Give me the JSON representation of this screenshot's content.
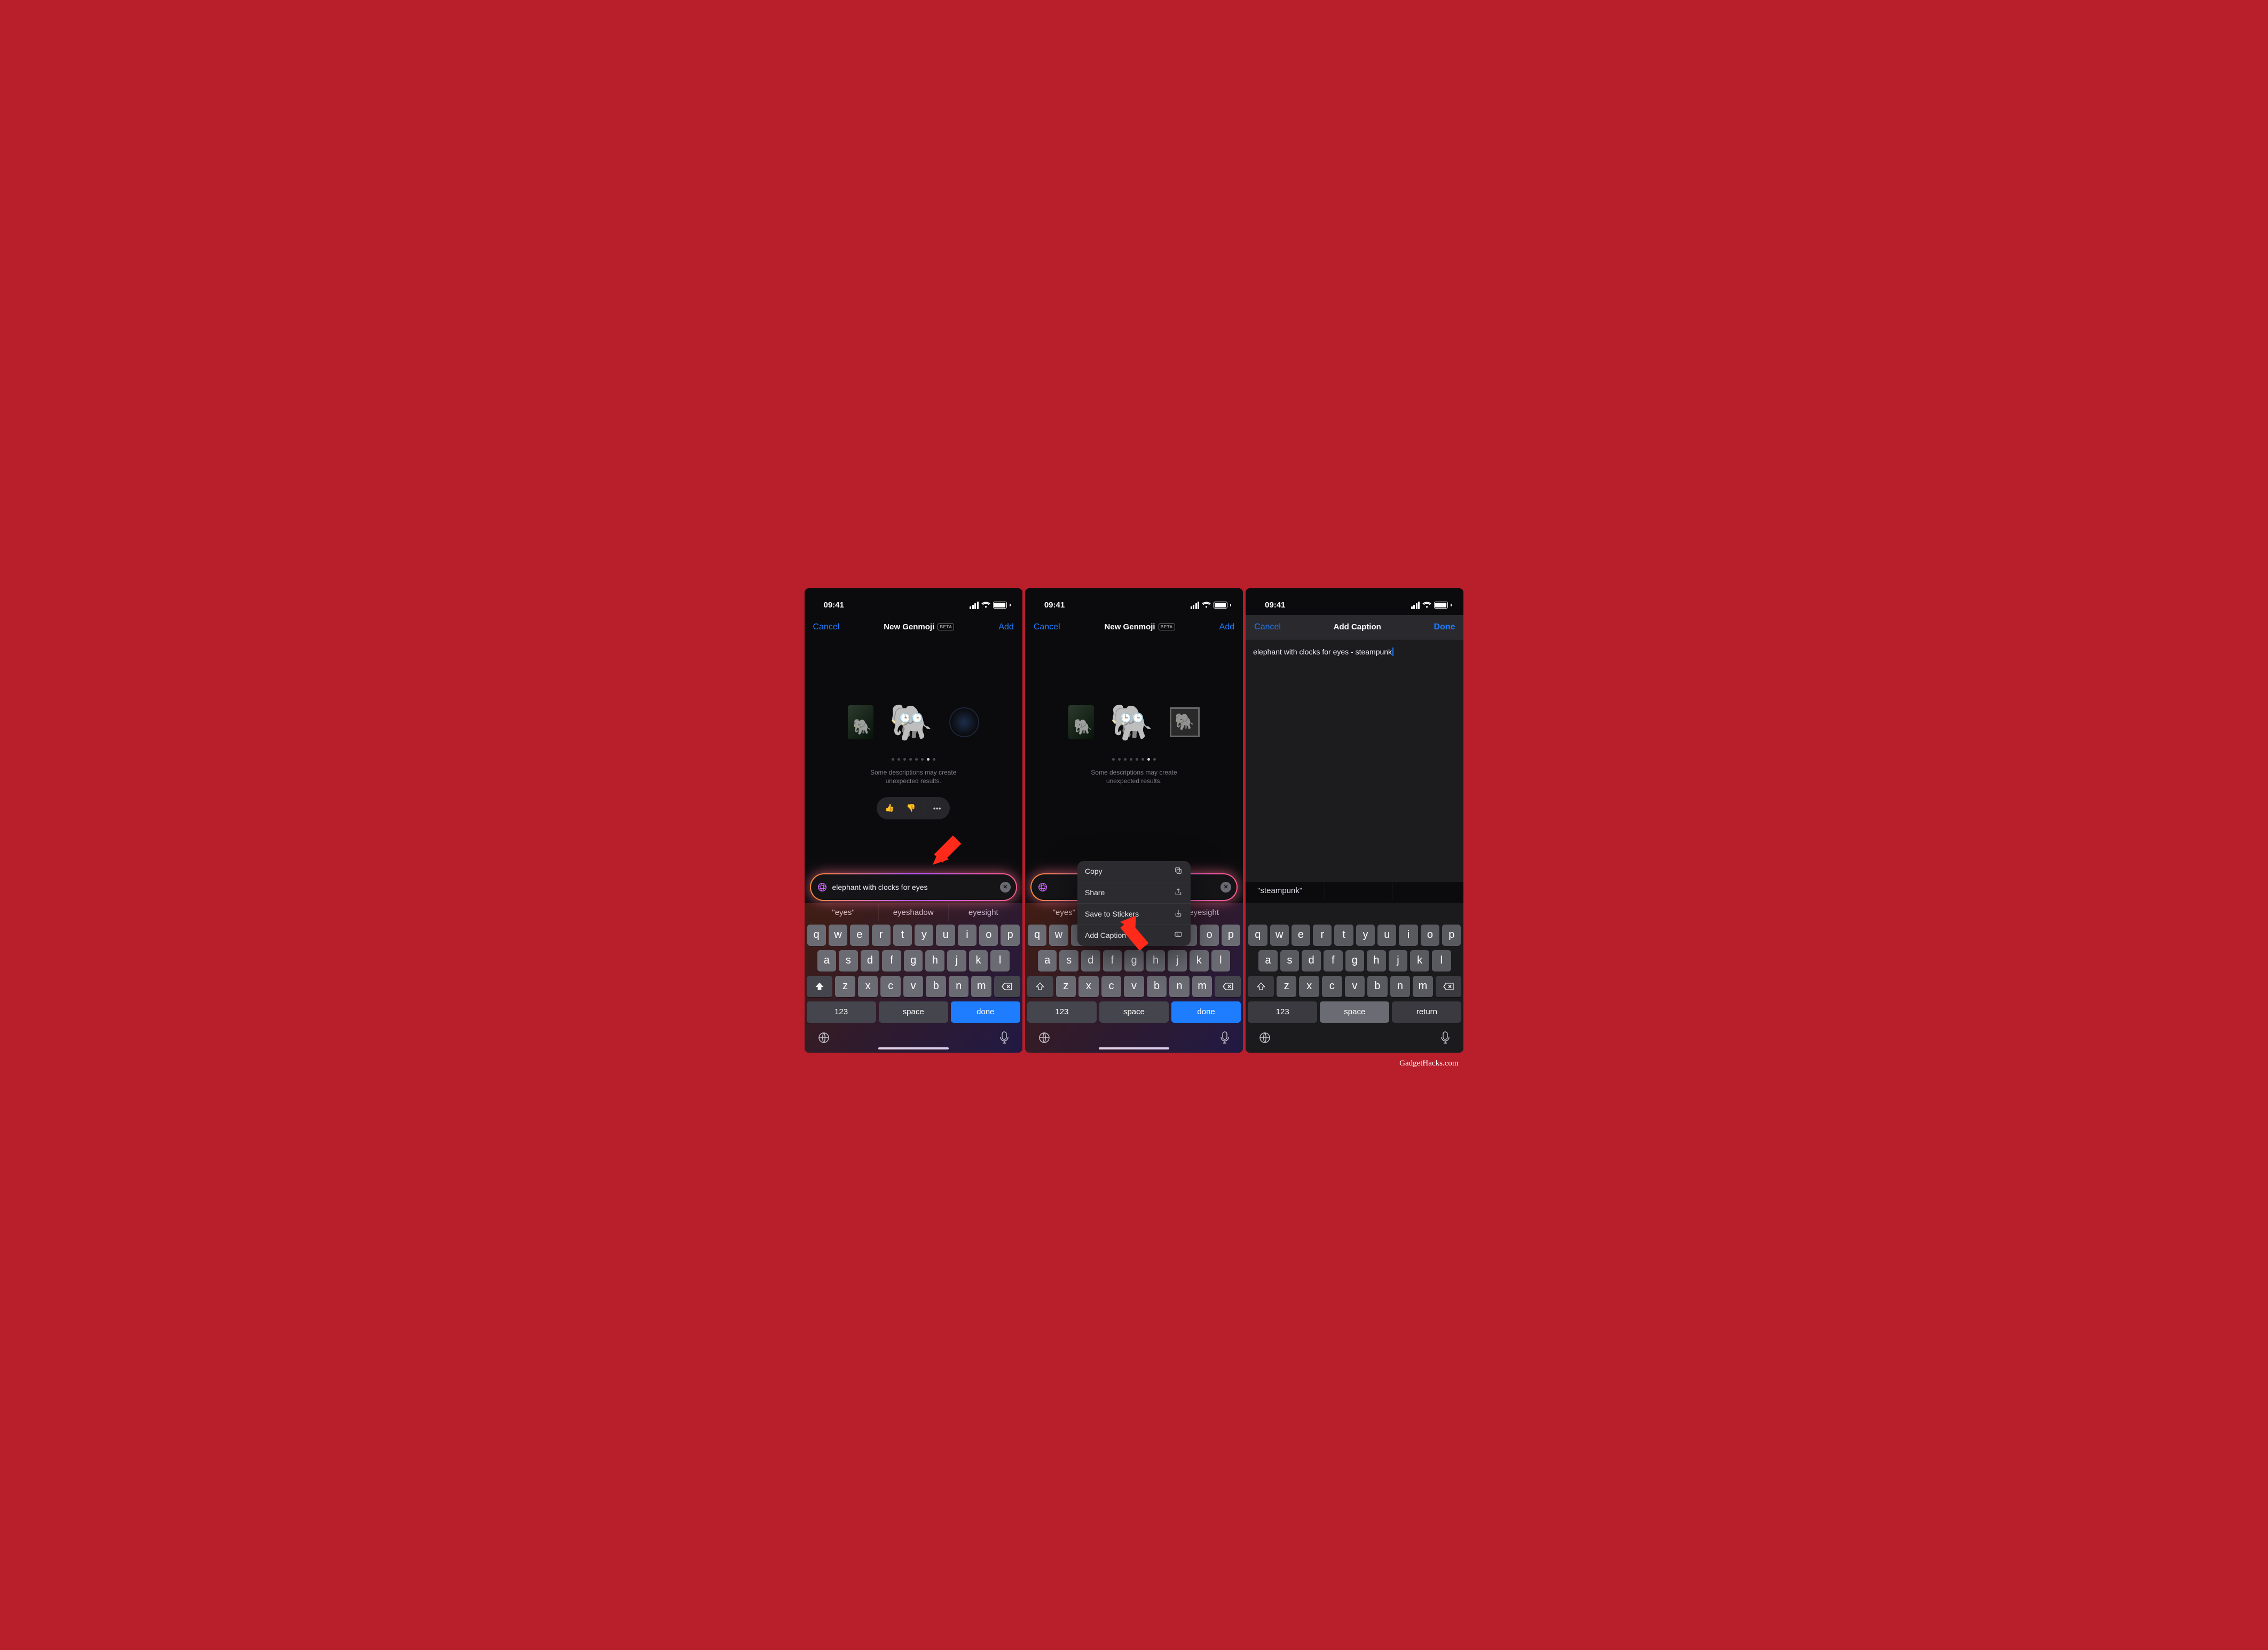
{
  "status": {
    "time": "09:41"
  },
  "phone12": {
    "nav": {
      "left": "Cancel",
      "title": "New Genmoji",
      "badge": "BETA",
      "right": "Add"
    },
    "desc_line1": "Some descriptions may create",
    "desc_line2": "unexpected results.",
    "prompt": "elephant with clocks for eyes",
    "autocomplete": [
      "\"eyes\"",
      "eyeshadow",
      "eyesight"
    ]
  },
  "context_menu": [
    {
      "label": "Copy",
      "icon": "copy"
    },
    {
      "label": "Share",
      "icon": "share"
    },
    {
      "label": "Save to Stickers",
      "icon": "save"
    },
    {
      "label": "Add Caption",
      "icon": "caption"
    }
  ],
  "phone3": {
    "nav": {
      "left": "Cancel",
      "title": "Add Caption",
      "right": "Done"
    },
    "text": "elephant with clocks for eyes - steampunk",
    "autocomplete": [
      "\"steampunk\"",
      "",
      ""
    ]
  },
  "kbd": {
    "r1": [
      "q",
      "w",
      "e",
      "r",
      "t",
      "y",
      "u",
      "i",
      "o",
      "p"
    ],
    "r2": [
      "a",
      "s",
      "d",
      "f",
      "g",
      "h",
      "j",
      "k",
      "l"
    ],
    "r3": [
      "z",
      "x",
      "c",
      "v",
      "b",
      "n",
      "m"
    ],
    "shift": "⇧",
    "back": "⌫",
    "num": "123",
    "space": "space",
    "done": "done",
    "return": "return"
  },
  "brand": "GadgetHacks.com"
}
